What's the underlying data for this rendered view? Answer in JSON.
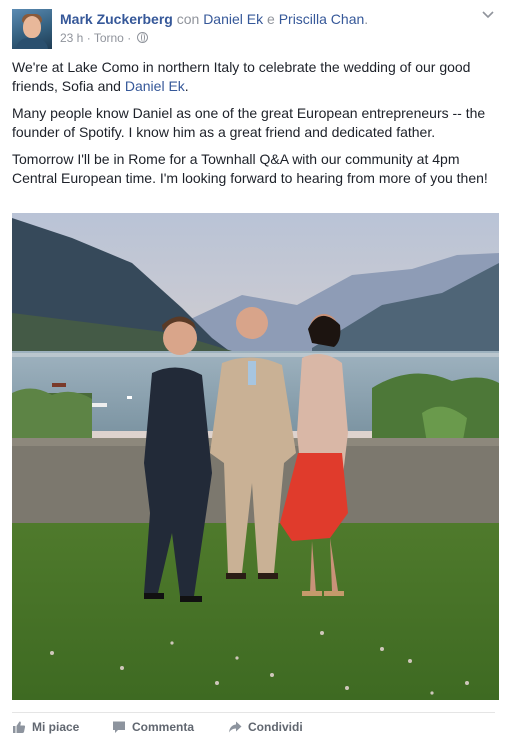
{
  "post": {
    "author": "Mark Zuckerberg",
    "with_text": "con",
    "tag1": "Daniel Ek",
    "and_text": "e",
    "tag2": "Priscilla Chan",
    "period": ".",
    "time": "23 h",
    "location": "Torno",
    "sep1": "·",
    "sep2": "·",
    "paragraph1": "We're at Lake Como in northern Italy to celebrate the wedding of our good friends, Sofia and",
    "paragraph1_link": "Daniel Ek",
    "paragraph1_end": ".",
    "paragraph2": "Many people know Daniel as one of the great European entrepreneurs -- the founder of Spotify. I know him as a great friend and dedicated father.",
    "paragraph3": "Tomorrow I'll be in Rome for a Townhall Q&A with our community at 4pm Central European time. I'm looking forward to hearing from more of you then!"
  },
  "actions": {
    "like": "Mi piace",
    "comment": "Commenta",
    "share": "Condividi"
  },
  "icons": {
    "avatar": "profile-photo",
    "privacy": "globe-icon",
    "menu": "chevron-down-icon",
    "like": "thumbs-up-icon",
    "comment": "speech-bubble-icon",
    "share": "share-arrow-icon"
  },
  "colors": {
    "link": "#365899",
    "text": "#1d2129",
    "meta": "#90949c",
    "action": "#616770"
  }
}
